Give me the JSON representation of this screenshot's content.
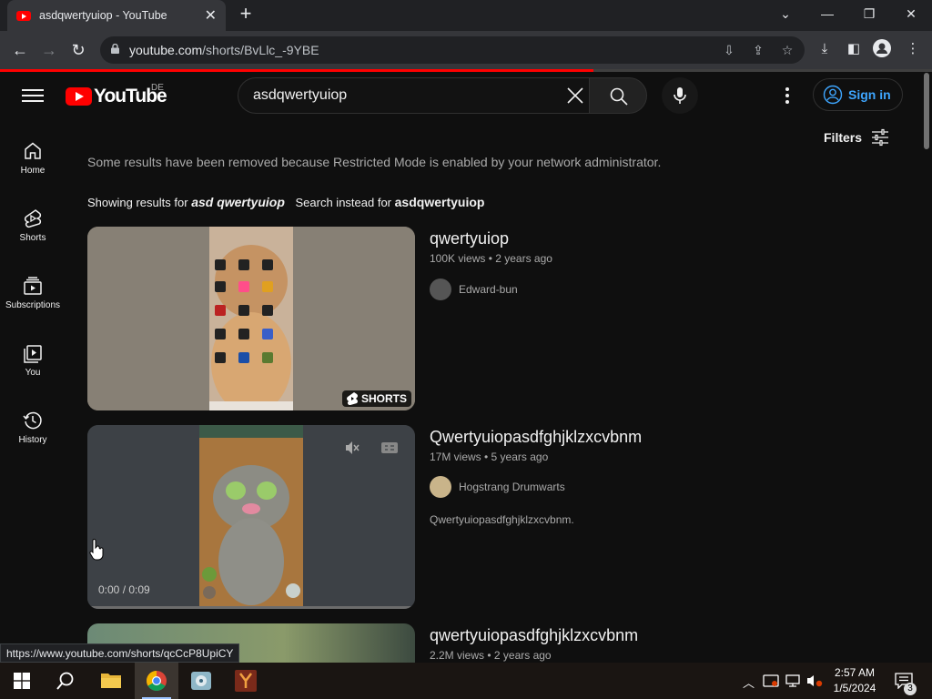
{
  "browser": {
    "tab_title": "asdqwertyuiop - YouTube",
    "url_host": "youtube.com",
    "url_path": "/shorts/BvLlc_-9YBE",
    "status_url": "https://www.youtube.com/shorts/qcCcP8UpiCY"
  },
  "header": {
    "logo_text": "YouTube",
    "region": "DE",
    "search_value": "asdqwertyuiop",
    "sign_in": "Sign in"
  },
  "sidebar": {
    "items": [
      {
        "label": "Home",
        "icon": "home-icon"
      },
      {
        "label": "Shorts",
        "icon": "shorts-icon"
      },
      {
        "label": "Subscriptions",
        "icon": "subscriptions-icon"
      },
      {
        "label": "You",
        "icon": "you-icon"
      },
      {
        "label": "History",
        "icon": "history-icon"
      }
    ]
  },
  "content": {
    "filters_label": "Filters",
    "restricted_notice": "Some results have been removed because Restricted Mode is enabled by your network administrator.",
    "showing_prefix": "Showing results for",
    "showing_query": "asd qwertyuiop",
    "instead_prefix": "Search instead for",
    "instead_query": "asdqwertyuiop"
  },
  "results": [
    {
      "title": "qwertyuiop",
      "meta": "100K views • 2 years ago",
      "channel": "Edward-bun",
      "badge": "SHORTS"
    },
    {
      "title": "Qwertyuiopasdfghjklzxcvbnm",
      "meta": "17M views • 5 years ago",
      "channel": "Hogstrang Drumwarts",
      "description": "Qwertyuiopasdfghjklzxcvbnm.",
      "time": "0:00 / 0:09"
    },
    {
      "title": "qwertyuiopasdfghjklzxcvbnm",
      "meta": "2.2M views • 2 years ago"
    }
  ],
  "taskbar": {
    "time": "2:57 AM",
    "date": "1/5/2024",
    "notifications": "3"
  }
}
